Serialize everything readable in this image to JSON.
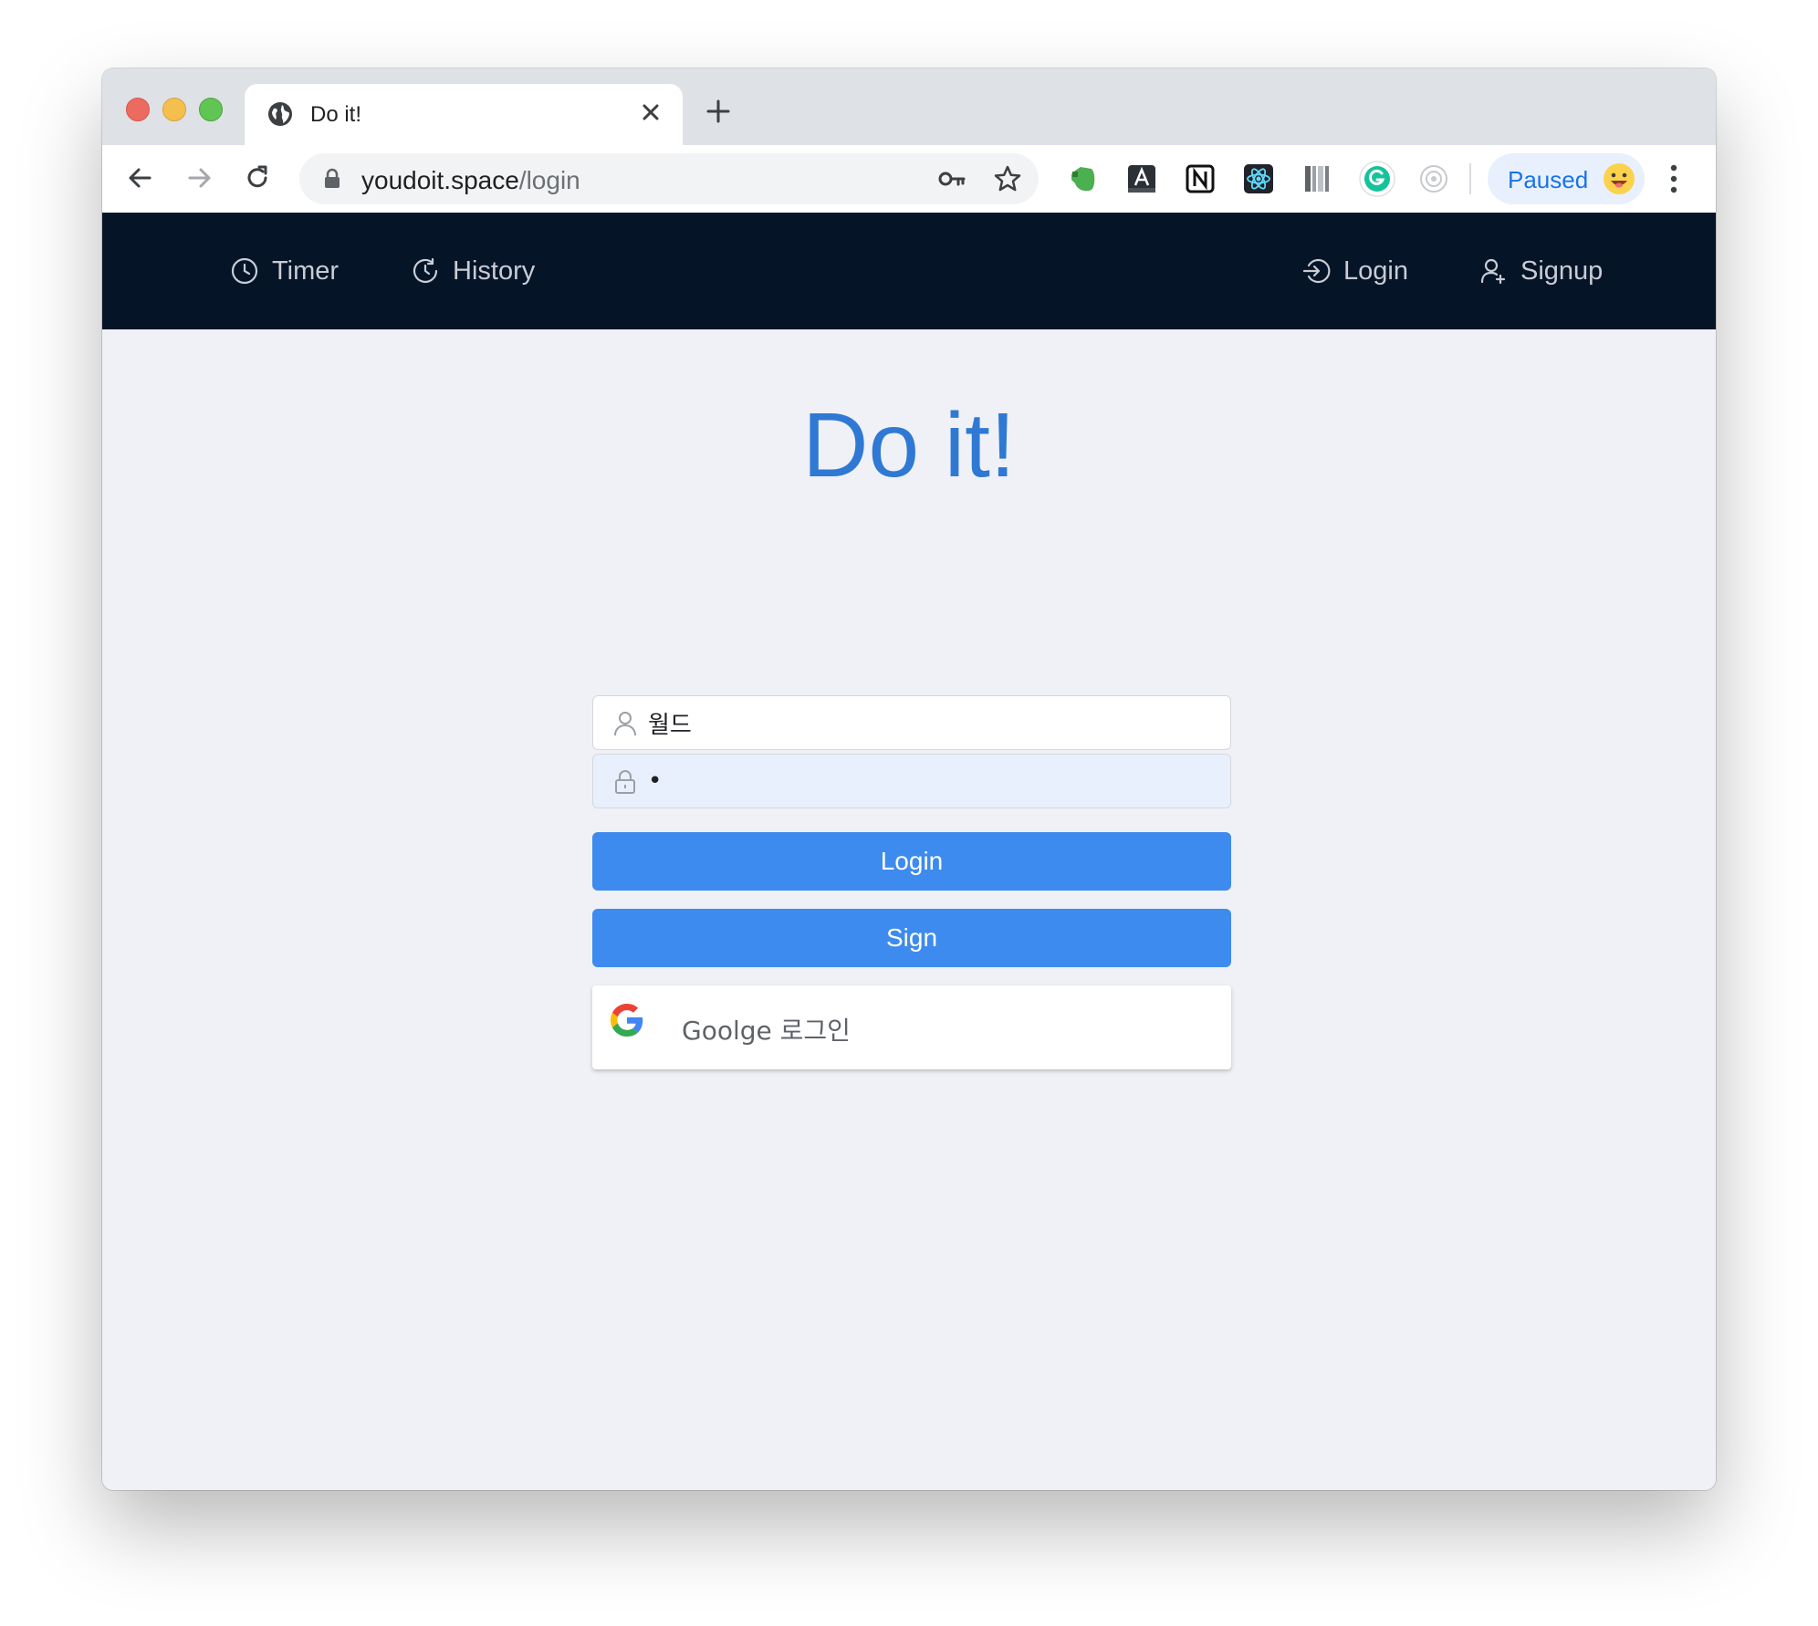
{
  "browser": {
    "tab_title": "Do it!",
    "url_host": "youdoit.space",
    "url_path": "/login",
    "profile_label": "Paused"
  },
  "nav": {
    "left": [
      {
        "label": "Timer",
        "icon": "clock-icon"
      },
      {
        "label": "History",
        "icon": "history-icon"
      }
    ],
    "right": [
      {
        "label": "Login",
        "icon": "login-icon"
      },
      {
        "label": "Signup",
        "icon": "user-add-icon"
      }
    ]
  },
  "page": {
    "title": "Do it!",
    "username_value": "월드",
    "password_value": "•",
    "login_button": "Login",
    "sign_button": "Sign",
    "google_button": "Goolge 로그인"
  },
  "colors": {
    "nav_bg": "#061428",
    "title": "#2f79d4",
    "primary_button": "#3d8bef",
    "page_bg": "#eff1f6"
  }
}
